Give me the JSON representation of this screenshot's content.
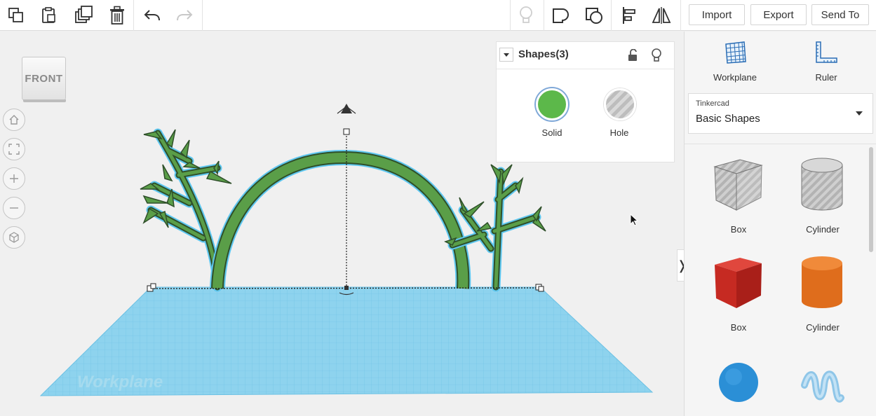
{
  "toolbar": {
    "copy_icon": "copy-icon",
    "paste_icon": "paste-icon",
    "duplicate_icon": "duplicate-icon",
    "delete_icon": "trash-icon",
    "undo_icon": "undo-icon",
    "redo_icon": "redo-icon",
    "light_icon": "lightbulb-icon",
    "group_icon": "group-icon",
    "ungroup_icon": "ungroup-icon",
    "align_icon": "align-icon",
    "mirror_icon": "mirror-icon",
    "import_label": "Import",
    "export_label": "Export",
    "send_to_label": "Send To"
  },
  "viewcube": {
    "face_label": "FRONT"
  },
  "nav": [
    "home-icon",
    "fit-icon",
    "zoom-in-icon",
    "zoom-out-icon",
    "perspective-icon"
  ],
  "workplane_text": "Workplane",
  "inspector": {
    "title": "Shapes(3)",
    "solid_label": "Solid",
    "hole_label": "Hole",
    "solid_color": "#5cb84a"
  },
  "panel": {
    "workplane_label": "Workplane",
    "ruler_label": "Ruler",
    "library_caption": "Tinkercad",
    "library_name": "Basic Shapes",
    "shapes": [
      {
        "label": "Box",
        "kind": "hole-box"
      },
      {
        "label": "Cylinder",
        "kind": "hole-cylinder"
      },
      {
        "label": "Box",
        "kind": "box",
        "color": "#d9332b"
      },
      {
        "label": "Cylinder",
        "kind": "cylinder",
        "color": "#e47422"
      },
      {
        "label": "",
        "kind": "sphere",
        "color": "#2b8fd6"
      },
      {
        "label": "",
        "kind": "scribble",
        "color": "#8fc6e8"
      }
    ]
  },
  "colors": {
    "workplane": "#8ed3ee",
    "grid": "#5fb8dc",
    "shape_green": "#5a9e48",
    "outline": "#2f4f2a",
    "selection": "#5ec7f0"
  }
}
